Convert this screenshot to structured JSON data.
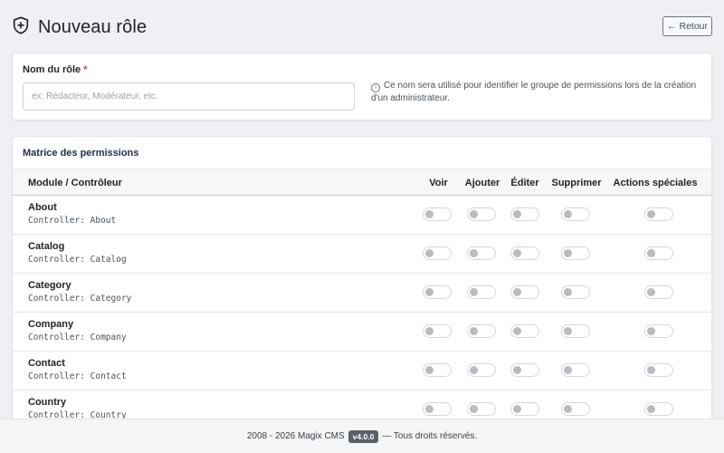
{
  "header": {
    "title": "Nouveau rôle",
    "back_label": "Retour",
    "back_arrow": "←"
  },
  "role_form": {
    "label": "Nom du rôle",
    "required_mark": "*",
    "input_value": "",
    "input_placeholder": "ex: Rédacteur, Modérateur, etc.",
    "help_icon": "ⓘ",
    "help_text": "Ce nom sera utilisé pour identifier le groupe de permissions lors de la création d'un administrateur."
  },
  "matrix": {
    "title": "Matrice des permissions",
    "columns": {
      "module": "Module / Contrôleur",
      "view": "Voir",
      "add": "Ajouter",
      "edit": "Éditer",
      "delete": "Supprimer",
      "special": "Actions spéciales"
    },
    "rows": [
      {
        "name": "About",
        "controller": "Controller: About"
      },
      {
        "name": "Catalog",
        "controller": "Controller: Catalog"
      },
      {
        "name": "Category",
        "controller": "Controller: Category"
      },
      {
        "name": "Company",
        "controller": "Controller: Company"
      },
      {
        "name": "Contact",
        "controller": "Controller: Contact"
      },
      {
        "name": "Country",
        "controller": "Controller: Country"
      }
    ]
  },
  "footer": {
    "copyright": "2008 - 2026 Magix CMS",
    "version": "v4.0.0",
    "rights": "— Tous droits réservés."
  },
  "colors": {
    "background": "#eef0f3",
    "card": "#ffffff",
    "matrix_title": "#1c2e4a",
    "required": "#dc3545",
    "toggle_off": "#b8bcc1",
    "version_badge": "#5a6168"
  },
  "icons": {
    "title": "shield-plus-icon",
    "back": "arrow-left-icon",
    "help": "info-circle-icon"
  }
}
